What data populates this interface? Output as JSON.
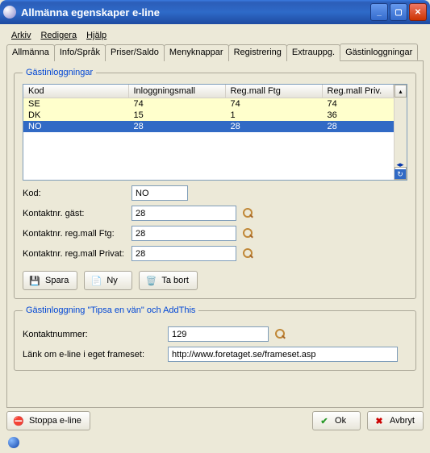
{
  "window": {
    "title": "Allmänna egenskaper e-line"
  },
  "menu": {
    "arkiv": "Arkiv",
    "redigera": "Redigera",
    "hjalp": "Hjälp"
  },
  "tabs": [
    "Allmänna",
    "Info/Språk",
    "Priser/Saldo",
    "Menyknappar",
    "Registrering",
    "Extrauppg.",
    "Gästinloggningar"
  ],
  "active_tab": 6,
  "grid": {
    "legend": "Gästinloggningar",
    "headers": [
      "Kod",
      "Inloggningsmall",
      "Reg.mall Ftg",
      "Reg.mall Priv."
    ],
    "rows": [
      {
        "kod": "SE",
        "inlogg": "74",
        "ftg": "74",
        "priv": "74"
      },
      {
        "kod": "DK",
        "inlogg": "15",
        "ftg": "1",
        "priv": "36"
      },
      {
        "kod": "NO",
        "inlogg": "28",
        "ftg": "28",
        "priv": "28"
      }
    ],
    "selected_index": 2
  },
  "form": {
    "kod_label": "Kod:",
    "kod_value": "NO",
    "gast_label": "Kontaktnr. gäst:",
    "gast_value": "28",
    "ftg_label": "Kontaktnr. reg.mall Ftg:",
    "ftg_value": "28",
    "priv_label": "Kontaktnr. reg.mall Privat:",
    "priv_value": "28"
  },
  "buttons": {
    "spara": "Spara",
    "ny": "Ny",
    "tabort": "Ta bort"
  },
  "tipsa": {
    "legend": "Gästinloggning \"Tipsa en vän\" och AddThis",
    "kontakt_label": "Kontaktnummer:",
    "kontakt_value": "129",
    "link_label": "Länk om e-line i eget frameset:",
    "link_value": "http://www.foretaget.se/frameset.asp"
  },
  "bottom": {
    "stoppa": "Stoppa e-line",
    "ok": "Ok",
    "avbryt": "Avbryt"
  }
}
